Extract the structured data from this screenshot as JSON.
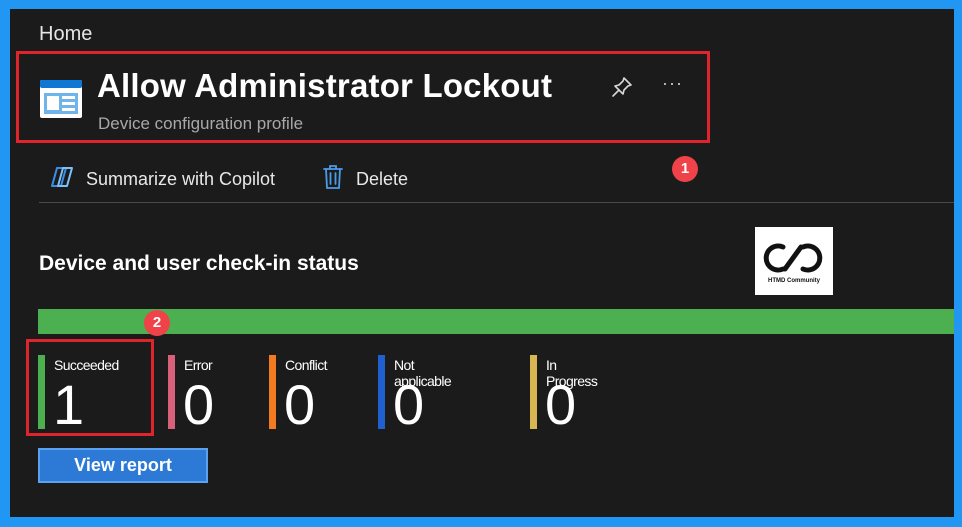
{
  "breadcrumb": "Home",
  "header": {
    "title": "Allow Administrator Lockout",
    "subtitle": "Device configuration profile",
    "pin_icon": "pin-icon",
    "more_label": "···"
  },
  "annotations": {
    "marker_1": "1",
    "marker_2": "2"
  },
  "commands": {
    "copilot_label": "Summarize with Copilot",
    "copilot_icon": "copilot-icon",
    "delete_label": "Delete",
    "delete_icon": "trash-icon"
  },
  "section": {
    "heading": "Device and user check-in status",
    "logo_text": "HTMD Community"
  },
  "status_bar": {
    "succeeded_fraction": 1.0,
    "color": "#4caf50"
  },
  "stats": [
    {
      "label": "Succeeded",
      "value": "1",
      "color": "#4caf50"
    },
    {
      "label": "Error",
      "value": "0",
      "color": "#d9607a"
    },
    {
      "label": "Conflict",
      "value": "0",
      "color": "#f47a20"
    },
    {
      "label": "Not applicable",
      "value": "0",
      "color": "#1f5fcf"
    },
    {
      "label": "In Progress",
      "value": "0",
      "color": "#d8b650"
    }
  ],
  "view_report_label": "View report"
}
